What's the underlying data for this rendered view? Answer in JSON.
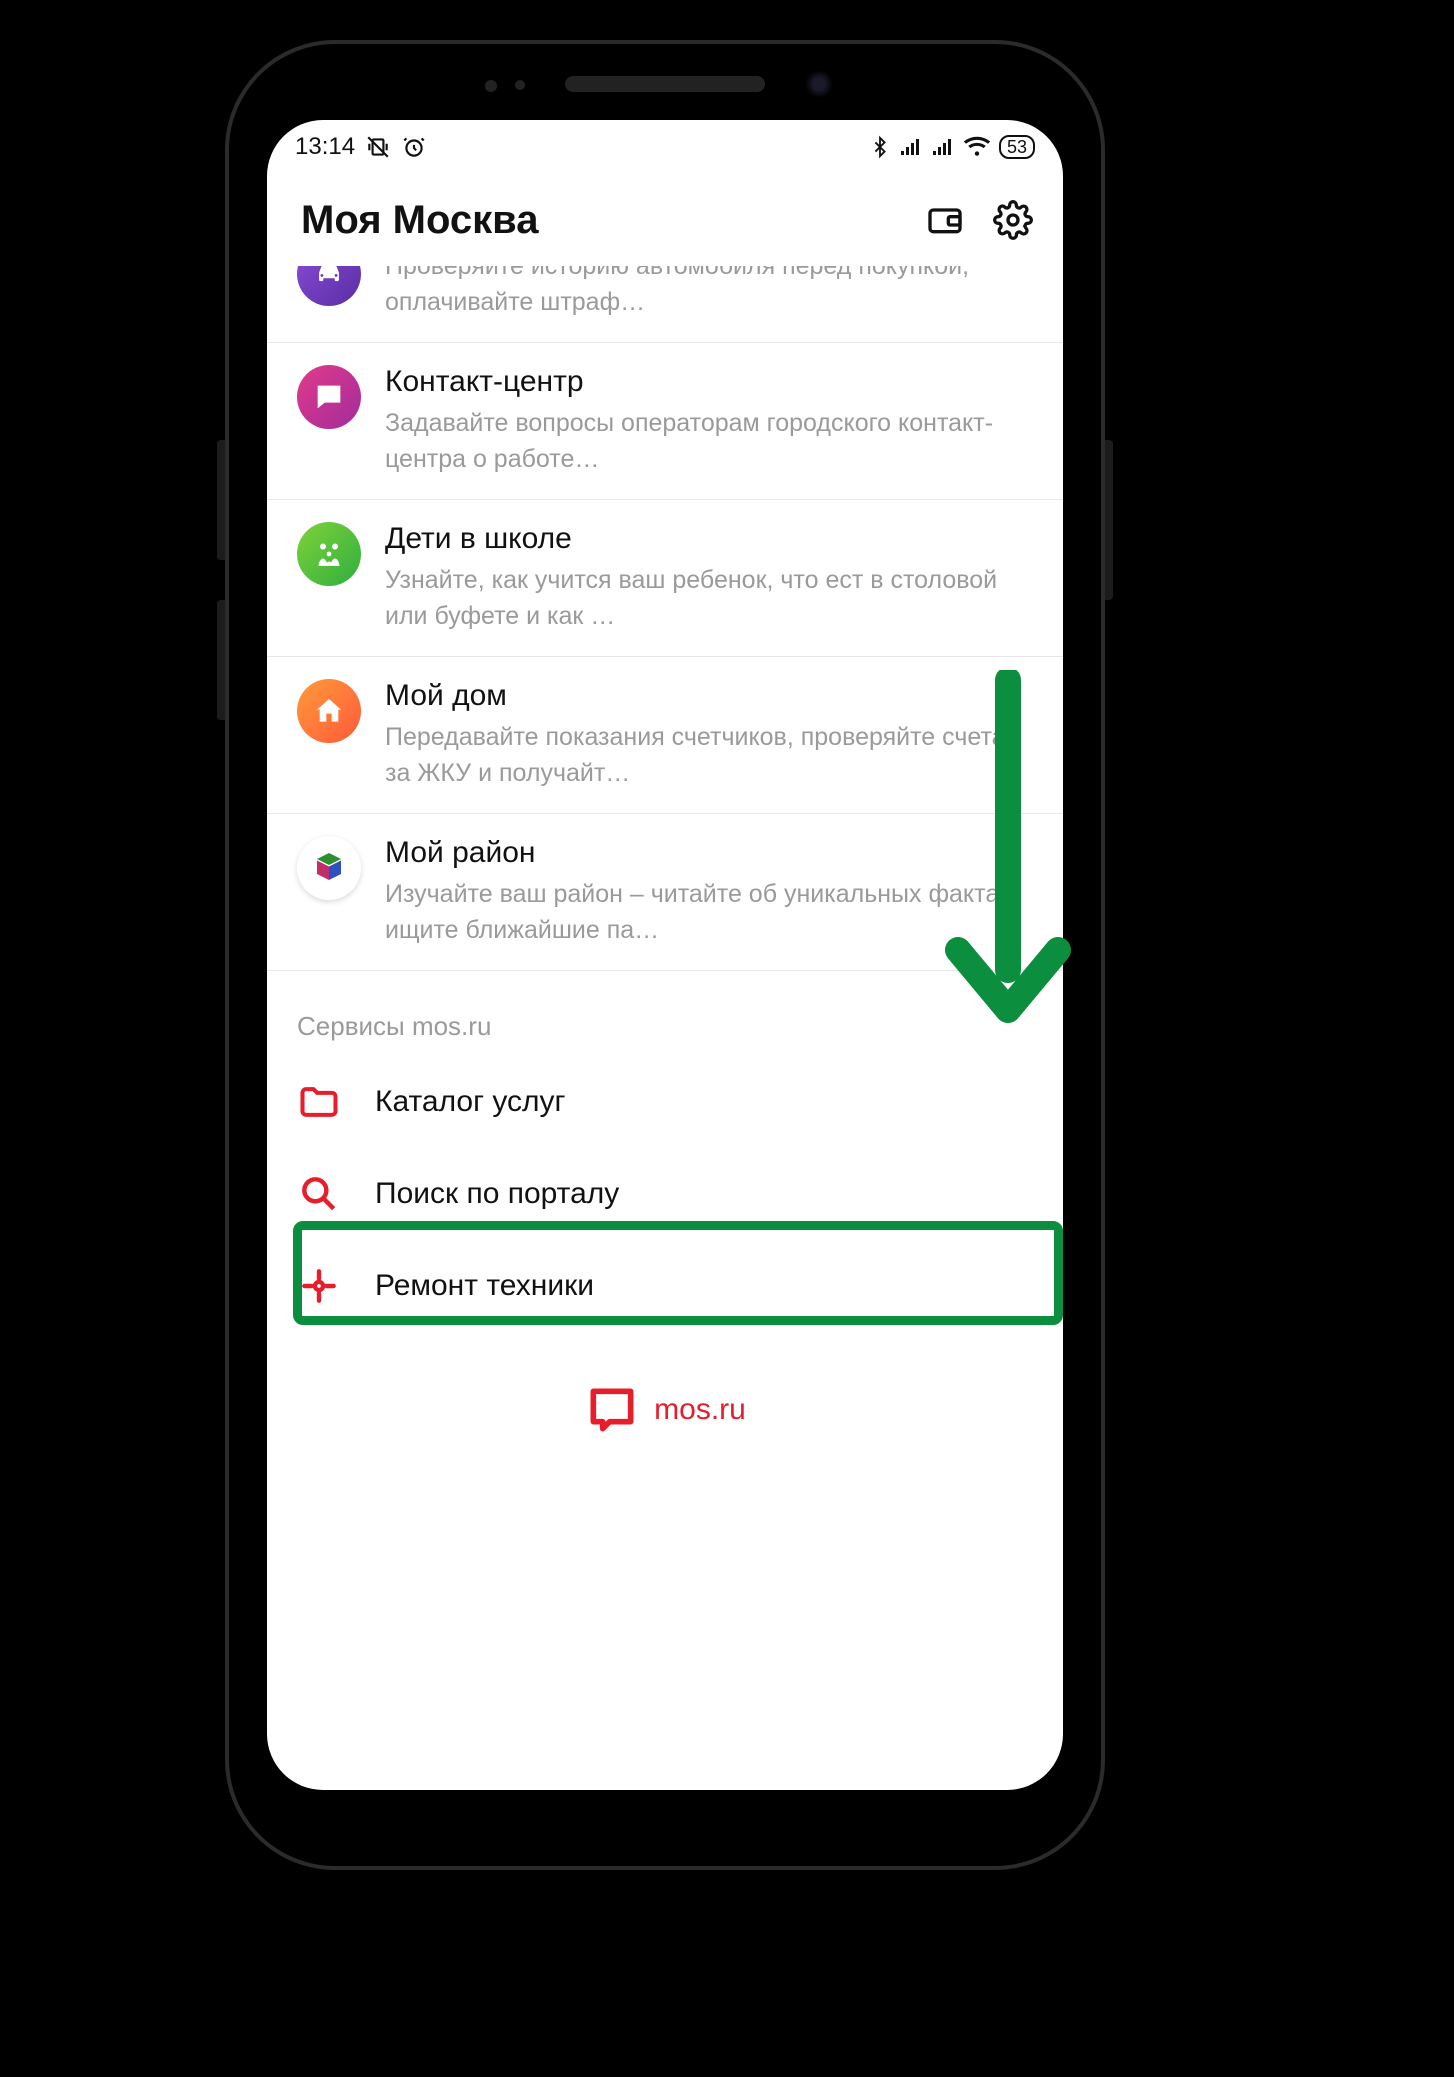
{
  "statusbar": {
    "time": "13:14",
    "battery": "53"
  },
  "header": {
    "title": "Моя Москва"
  },
  "rows": [
    {
      "title": "",
      "sub": "Проверяйте историю автомобиля перед покупкой, оплачивайте штраф…"
    },
    {
      "title": "Контакт-центр",
      "sub": "Задавайте вопросы операторам городского контакт-центра о работе…"
    },
    {
      "title": "Дети в школе",
      "sub": "Узнайте, как учится ваш ребенок, что ест в столовой или буфете и как …"
    },
    {
      "title": "Мой дом",
      "sub": "Передавайте показания счетчиков, проверяйте счета за ЖКУ и получайт…"
    },
    {
      "title": "Мой район",
      "sub": "Изучайте ваш район – читайте об уникальных фактах, ищите ближайшие па…"
    }
  ],
  "section_title": "Сервисы mos.ru",
  "services": [
    {
      "label": "Каталог услуг"
    },
    {
      "label": "Поиск по порталу"
    },
    {
      "label": "Ремонт техники"
    }
  ],
  "footer": {
    "brand": "mos.ru"
  }
}
